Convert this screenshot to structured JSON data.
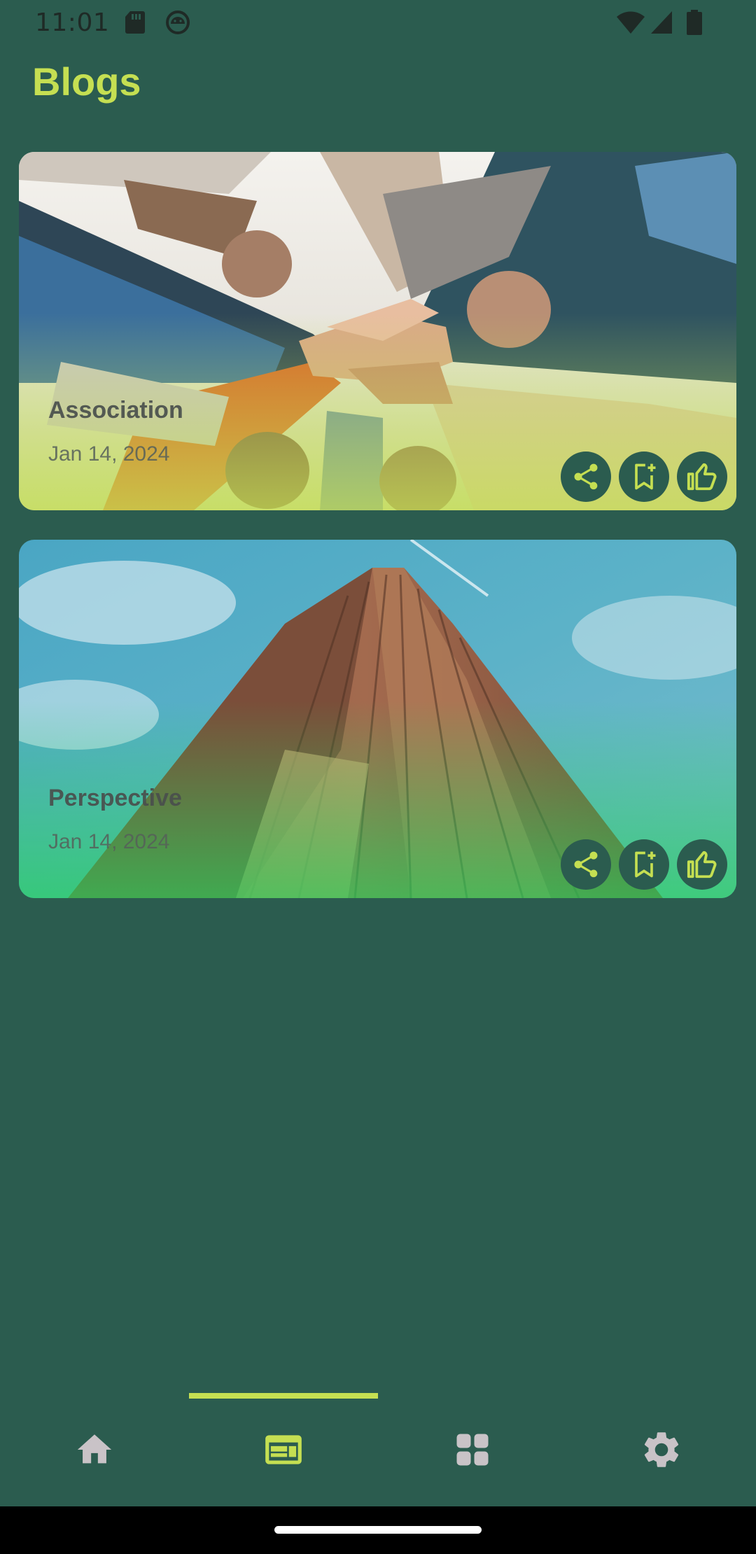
{
  "status_bar": {
    "time": "11:01",
    "left_icons": [
      "sd-card-icon",
      "android-debug-icon"
    ],
    "right_icons": [
      "wifi-icon",
      "cellular-signal-icon",
      "battery-icon"
    ]
  },
  "header": {
    "title": "Blogs"
  },
  "blogs": [
    {
      "title": "Association",
      "date": "Jan 14, 2024",
      "image": "group-hands-together-photo",
      "actions": [
        "share-icon",
        "bookmark-add-icon",
        "thumb-up-icon"
      ]
    },
    {
      "title": "Perspective",
      "date": "Jan 14, 2024",
      "image": "skyscraper-looking-up-photo",
      "actions": [
        "share-icon",
        "bookmark-add-icon",
        "thumb-up-icon"
      ]
    }
  ],
  "bottom_nav": {
    "items": [
      {
        "name": "home",
        "icon": "home-icon",
        "active": false
      },
      {
        "name": "blogs",
        "icon": "article-icon",
        "active": true
      },
      {
        "name": "categories",
        "icon": "grid-icon",
        "active": false
      },
      {
        "name": "settings",
        "icon": "gear-icon",
        "active": false
      }
    ]
  },
  "colors": {
    "background": "#2b5c4f",
    "accent": "#c5df52",
    "inactive_icon": "#c9c3c7",
    "action_button_bg": "#2b5c4f"
  }
}
